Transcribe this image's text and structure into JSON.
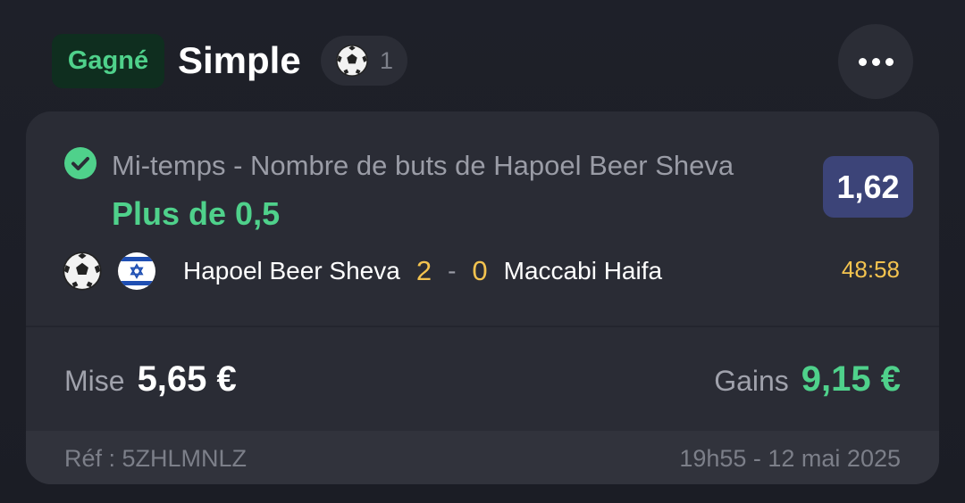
{
  "header": {
    "status": "Gagné",
    "bet_type": "Simple",
    "sport_icon": "soccer-ball-icon",
    "selections_count": "1",
    "more_icon": "more-horizontal-icon"
  },
  "bet": {
    "market": "Mi-temps - Nombre de buts de Hapoel Beer Sheva",
    "selection": "Plus de 0,5",
    "odds": "1,62",
    "status_icon": "check-circle-icon"
  },
  "match": {
    "sport_icon": "soccer-ball-icon",
    "flag_icon": "israel-flag-icon",
    "home_team": "Hapoel Beer Sheva",
    "home_score": "2",
    "separator": "-",
    "away_score": "0",
    "away_team": "Maccabi Haifa",
    "time": "48:58"
  },
  "stake": {
    "label": "Mise",
    "value": "5,65 €"
  },
  "gains": {
    "label": "Gains",
    "value": "9,15 €"
  },
  "footer": {
    "reference": "Réf : 5ZHLMNLZ",
    "date": "19h55 - 12 mai 2025"
  },
  "colors": {
    "background": "#1a1c24",
    "card": "#2a2c35",
    "win_green": "#4fd18b",
    "score_yellow": "#f3c34f",
    "odds_bg": "#3c4478"
  }
}
